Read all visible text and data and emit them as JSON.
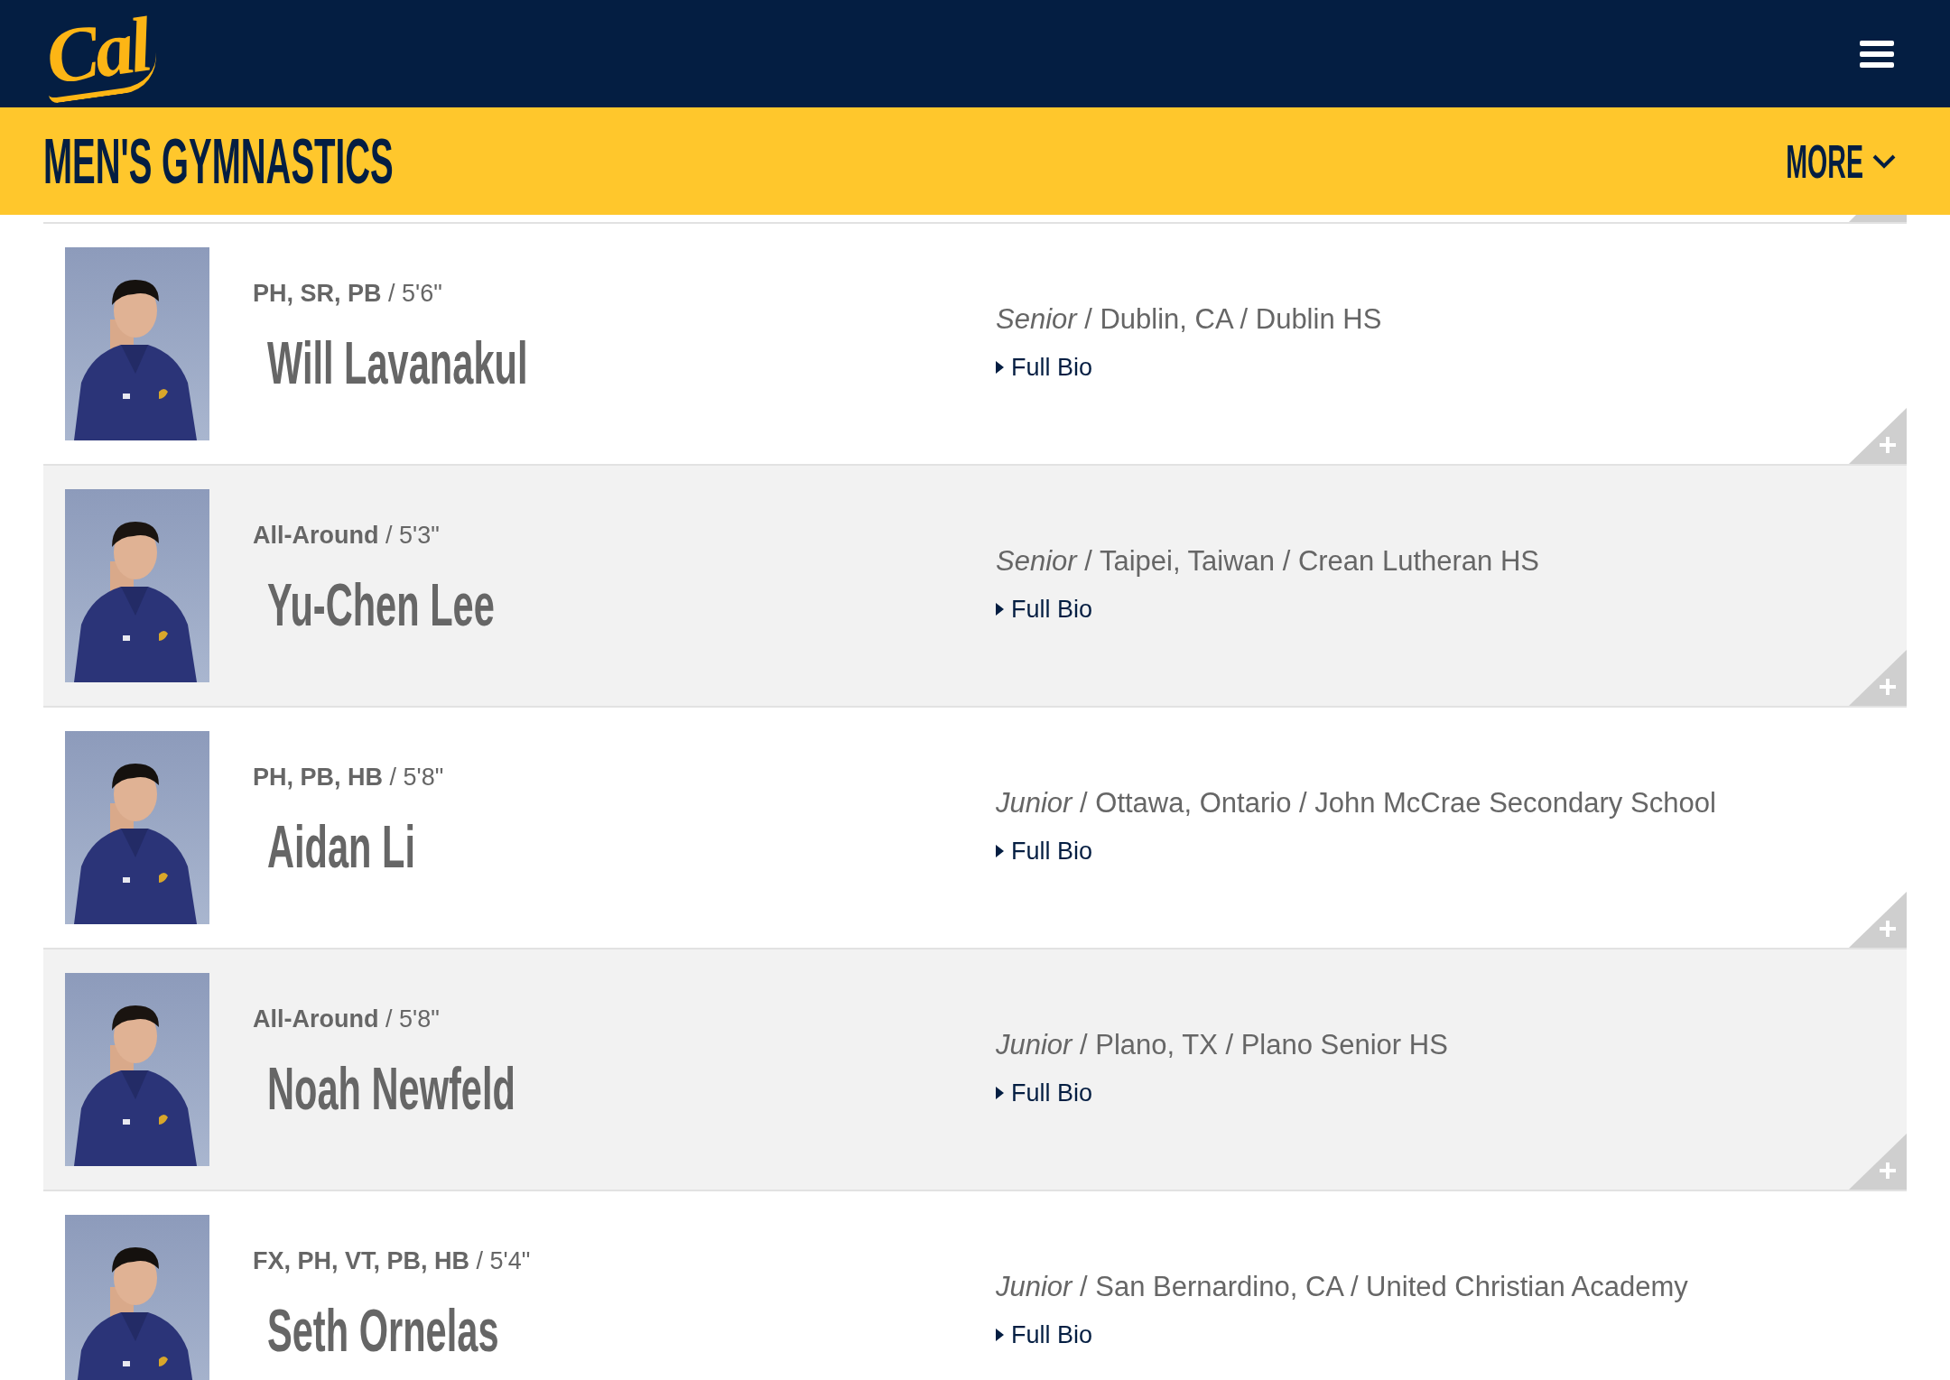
{
  "header": {
    "logo": "Cal"
  },
  "section": {
    "title": "MEN'S GYMNASTICS",
    "more": "MORE"
  },
  "roster": [
    {
      "kind": "picture",
      "positions": "**PH, SR, PB** / 5'6\"",
      "name": "Will Lavanakul",
      "details": "*Senior* / Dublin, CA / Dublin HS",
      "link": "Full Bio"
    },
    {
      "kind": "picture",
      "positions": "**All-Around** / 5'3\"",
      "name": "Yu-Chen Lee",
      "details": "*Senior* / Taipei, Taiwan / Crean Lutheran HS",
      "link": "Full Bio"
    },
    {
      "kind": "picture",
      "positions": "**PH, PB, HB** / 5'8\"",
      "name": "Aidan Li",
      "details": "*Junior* / Ottawa, Ontario / John McCrae Secondary School",
      "link": "Full Bio"
    },
    {
      "kind": "picture",
      "positions": "**All-Around** / 5'8\"",
      "name": "Noah Newfeld",
      "details": "*Junior* / Plano, TX / Plano Senior HS",
      "link": "Full Bio"
    },
    {
      "kind": "picture",
      "positions": "**FX, PH, VT, PB, HB** / 5'4\"",
      "name": "Seth Ornelas",
      "details": "*Junior* / San Bernardino, CA / United Christian Academy",
      "link": "Full Bio"
    }
  ]
}
